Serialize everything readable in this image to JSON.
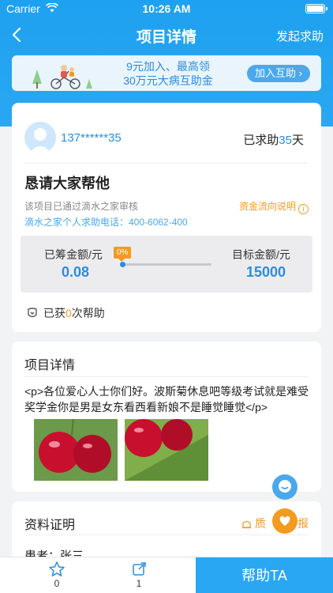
{
  "status_bar": {
    "carrier": "Carrier",
    "time": "10:26 AM"
  },
  "nav": {
    "title": "项目详情",
    "right_action": "发起求助"
  },
  "banner": {
    "line1": "9元加入、最高领",
    "line2": "30万元大病互助金",
    "button": "加入互助",
    "button_arrow": "›"
  },
  "user": {
    "phone": "137******35",
    "days_prefix": "已求助",
    "days_value": "35",
    "days_suffix": "天"
  },
  "project": {
    "heading": "恳请大家帮他",
    "audit_text": "该项目已通过滴水之家审核",
    "hotline": "滴水之家个人求助电话：400-6062-400",
    "fund_flow": "资金流向说明",
    "fund_flow_icon_glyph": "i"
  },
  "amounts": {
    "raised_label": "已筹金额/元",
    "raised_value": "0.08",
    "progress_label": "0%",
    "progress_fraction": 0.0,
    "target_label": "目标金额/元",
    "target_value": "15000"
  },
  "helped": {
    "prefix": "已获",
    "count": "0",
    "suffix": "次帮助"
  },
  "details": {
    "title": "项目详情",
    "description": "<p>各位爱心人士你们好。波斯菊休息吧等级考试就是难受奖学金你是男是女东看西看新娘不是睡觉睡觉</p>"
  },
  "proof": {
    "title": "资料证明",
    "report_label_left": "质",
    "report_label_right": "报",
    "patient": "患者：张三"
  },
  "bottom_bar": {
    "favorite_count": "0",
    "share_count": "1",
    "help_button": "帮助TA"
  },
  "colors": {
    "primary": "#2aa7f2",
    "accent": "#f39a20",
    "link": "#2a8de0"
  },
  "icons": [
    "back-icon",
    "wifi-icon",
    "battery-icon",
    "user-avatar-icon",
    "info-icon",
    "heart-hand-icon",
    "star-icon",
    "share-icon",
    "chat-icon",
    "report-icon"
  ]
}
